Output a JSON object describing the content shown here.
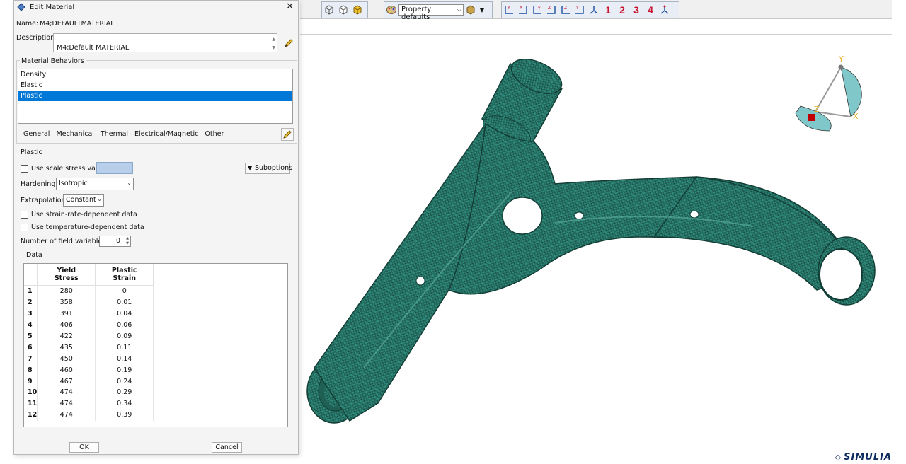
{
  "toolbar": {
    "property_select": "Property defaults",
    "view_numbers": [
      "1",
      "2",
      "3",
      "4"
    ]
  },
  "viewport": {
    "triad_labels": {
      "y": "Y",
      "x": "X",
      "z": "Z"
    },
    "brand": "SIMULIA"
  },
  "dialog": {
    "title": "Edit Material",
    "name_label": "Name:",
    "name_value": "M4;DEFAULTMATERIAL",
    "description_label": "Description:",
    "description_value": "M4;Default MATERIAL",
    "behaviors_title": "Material Behaviors",
    "behaviors": [
      "Density",
      "Elastic",
      "Plastic"
    ],
    "selected_behavior": "Plastic",
    "menu": [
      "General",
      "Mechanical",
      "Thermal",
      "Electrical/Magnetic",
      "Other"
    ],
    "plastic": {
      "section_title": "Plastic",
      "scale_stress_label": "Use scale stress value:",
      "suboptions_label": "Suboptions",
      "hardening_label": "Hardening:",
      "hardening_value": "Isotropic",
      "extrapolation_label": "Extrapolation:",
      "extrapolation_value": "Constant",
      "strain_rate_label": "Use strain-rate-dependent data",
      "temperature_label": "Use temperature-dependent data",
      "field_vars_label": "Number of field variables:",
      "field_vars_value": "0",
      "data_title": "Data",
      "columns": [
        {
          "line1": "Yield",
          "line2": "Stress"
        },
        {
          "line1": "Plastic",
          "line2": "Strain"
        }
      ],
      "rows": [
        [
          "280",
          "0"
        ],
        [
          "358",
          "0.01"
        ],
        [
          "391",
          "0.04"
        ],
        [
          "406",
          "0.06"
        ],
        [
          "422",
          "0.09"
        ],
        [
          "435",
          "0.11"
        ],
        [
          "450",
          "0.14"
        ],
        [
          "460",
          "0.19"
        ],
        [
          "467",
          "0.24"
        ],
        [
          "474",
          "0.29"
        ],
        [
          "474",
          "0.34"
        ],
        [
          "474",
          "0.39"
        ]
      ]
    },
    "ok_label": "OK",
    "cancel_label": "Cancel"
  },
  "colors": {
    "mesh": "#2f8a7b",
    "selection": "#0078d7",
    "accent_red": "#c8102e"
  }
}
